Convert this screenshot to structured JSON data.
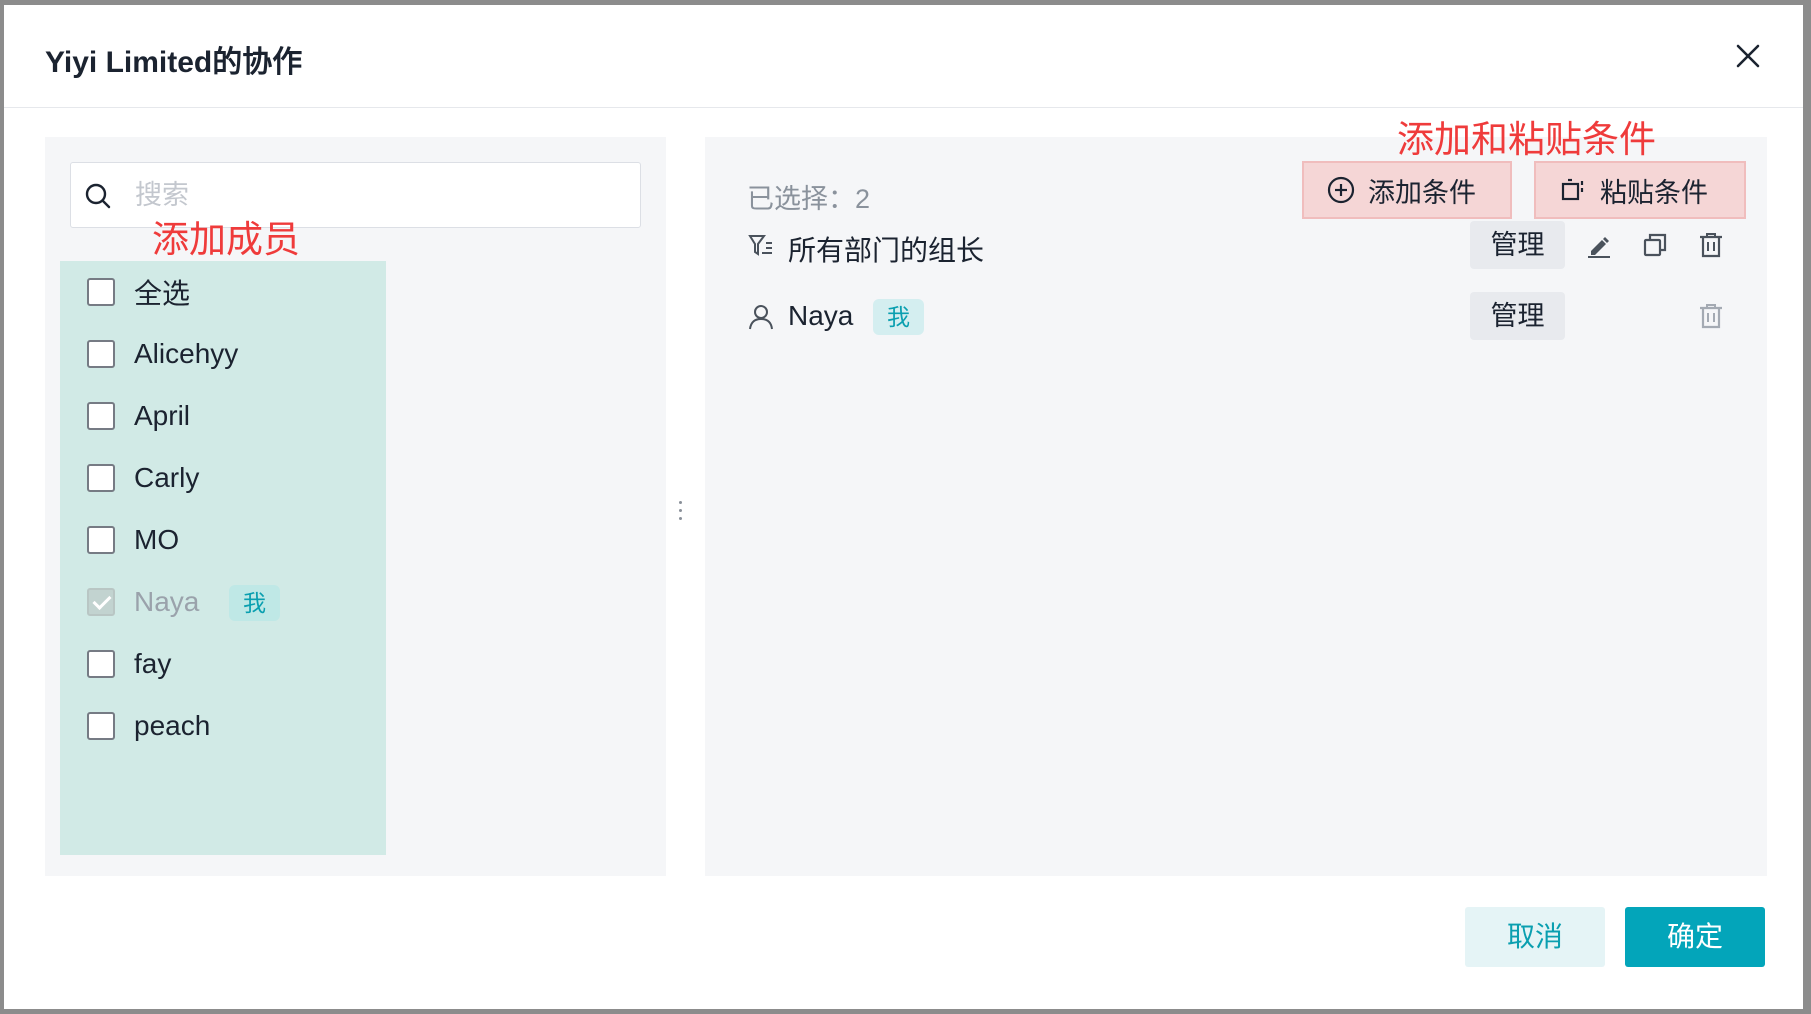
{
  "dialog": {
    "title": "Yiyi Limited的协作",
    "close_icon": "close-icon"
  },
  "left": {
    "search_placeholder": "搜索",
    "annotation": "添加成员",
    "members": [
      {
        "label": "全选",
        "checked": false
      },
      {
        "label": "Alicehyy",
        "checked": false
      },
      {
        "label": "April",
        "checked": false
      },
      {
        "label": "Carly",
        "checked": false
      },
      {
        "label": "MO",
        "checked": false
      },
      {
        "label": "Naya",
        "checked": true,
        "disabled": true,
        "badge": "我"
      },
      {
        "label": "fay",
        "checked": false
      },
      {
        "label": "peach",
        "checked": false
      }
    ]
  },
  "right": {
    "selected_label": "已选择：2",
    "annotation": "添加和粘贴条件",
    "add_condition_label": "添加条件",
    "paste_condition_label": "粘贴条件",
    "rows": [
      {
        "icon": "filter-icon",
        "text": "所有部门的组长",
        "manage": "管理",
        "actions": [
          "edit-icon",
          "copy-icon",
          "delete-icon"
        ]
      },
      {
        "icon": "user-icon",
        "text": "Naya",
        "badge": "我",
        "manage": "管理",
        "actions": [
          "delete-icon"
        ]
      }
    ]
  },
  "footer": {
    "cancel_label": "取消",
    "ok_label": "确定"
  },
  "colors": {
    "accent": "#03a5ba",
    "annotation": "#ef3b3b",
    "highlight_members": "#d1eae6",
    "highlight_buttons": "#f5d6d6"
  }
}
